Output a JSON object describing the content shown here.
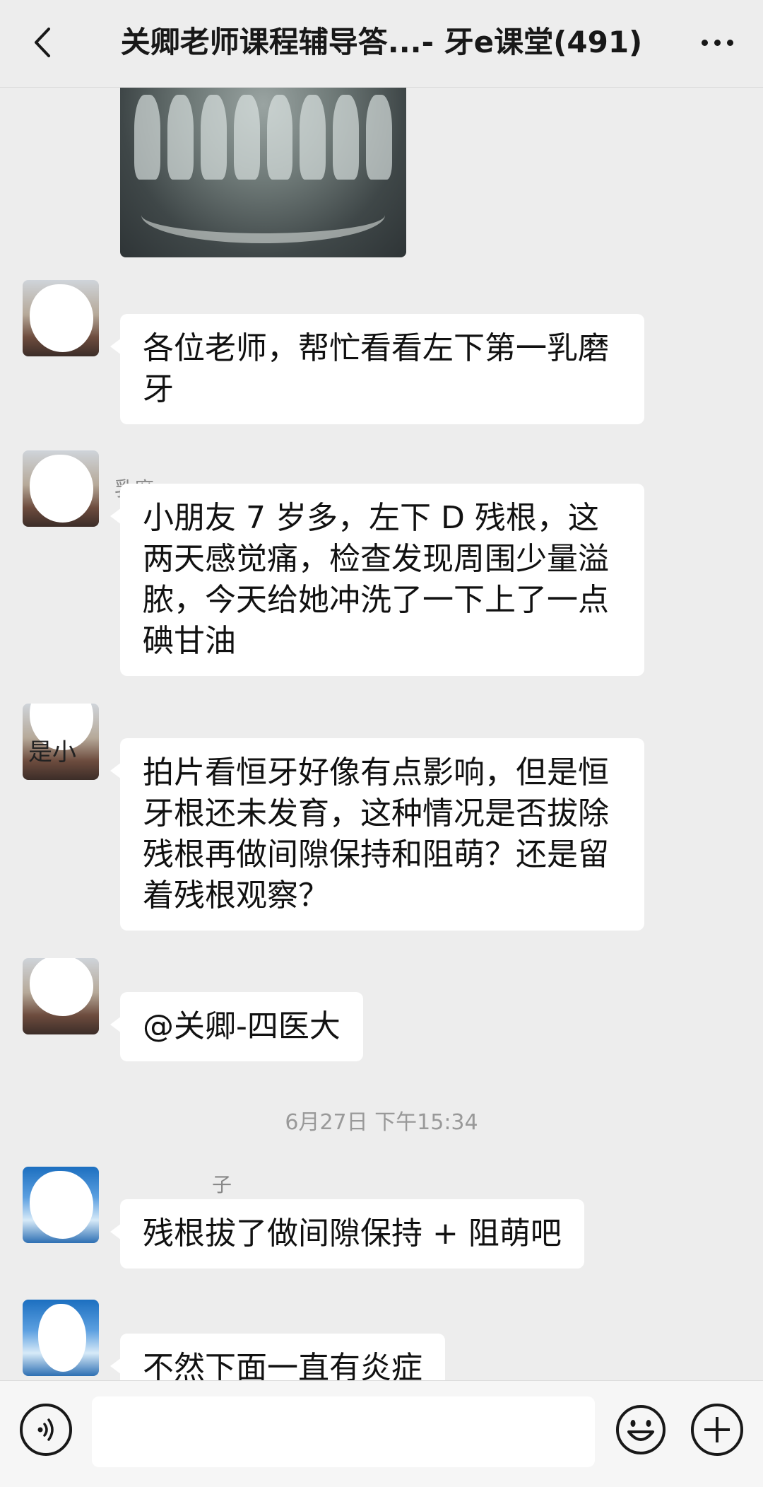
{
  "header": {
    "title": "关卿老师课程辅导答...- 牙e课堂(491)",
    "back_icon": "chevron-left-icon",
    "more_icon": "more-dots-icon"
  },
  "messages": [
    {
      "type": "image",
      "description": "dental-xray-image"
    },
    {
      "type": "text",
      "text": "各位老师，帮忙看看左下第一乳磨牙"
    },
    {
      "type": "text",
      "name_fragment": "乳磨",
      "text": "小朋友 7 岁多，左下 D 残根，这两天感觉痛，检查发现周围少量溢脓，今天给她冲洗了一下上了一点碘甘油"
    },
    {
      "type": "text",
      "name_fragment": "是小",
      "text": "拍片看恒牙好像有点影响，但是恒牙根还未发育，这种情况是否拔除残根再做间隙保持和阻萌？还是留着残根观察？"
    },
    {
      "type": "text",
      "text": "@关卿-四医大"
    },
    {
      "type": "text",
      "name_fragment": "子",
      "text": "残根拔了做间隙保持 + 阻萌吧"
    },
    {
      "type": "text",
      "text": "不然下面一直有炎症"
    }
  ],
  "timestamp": "6月27日 下午15:34",
  "composer": {
    "voice_icon": "voice-icon",
    "input_value": "",
    "emoji_icon": "emoji-icon",
    "plus_icon": "plus-icon"
  }
}
